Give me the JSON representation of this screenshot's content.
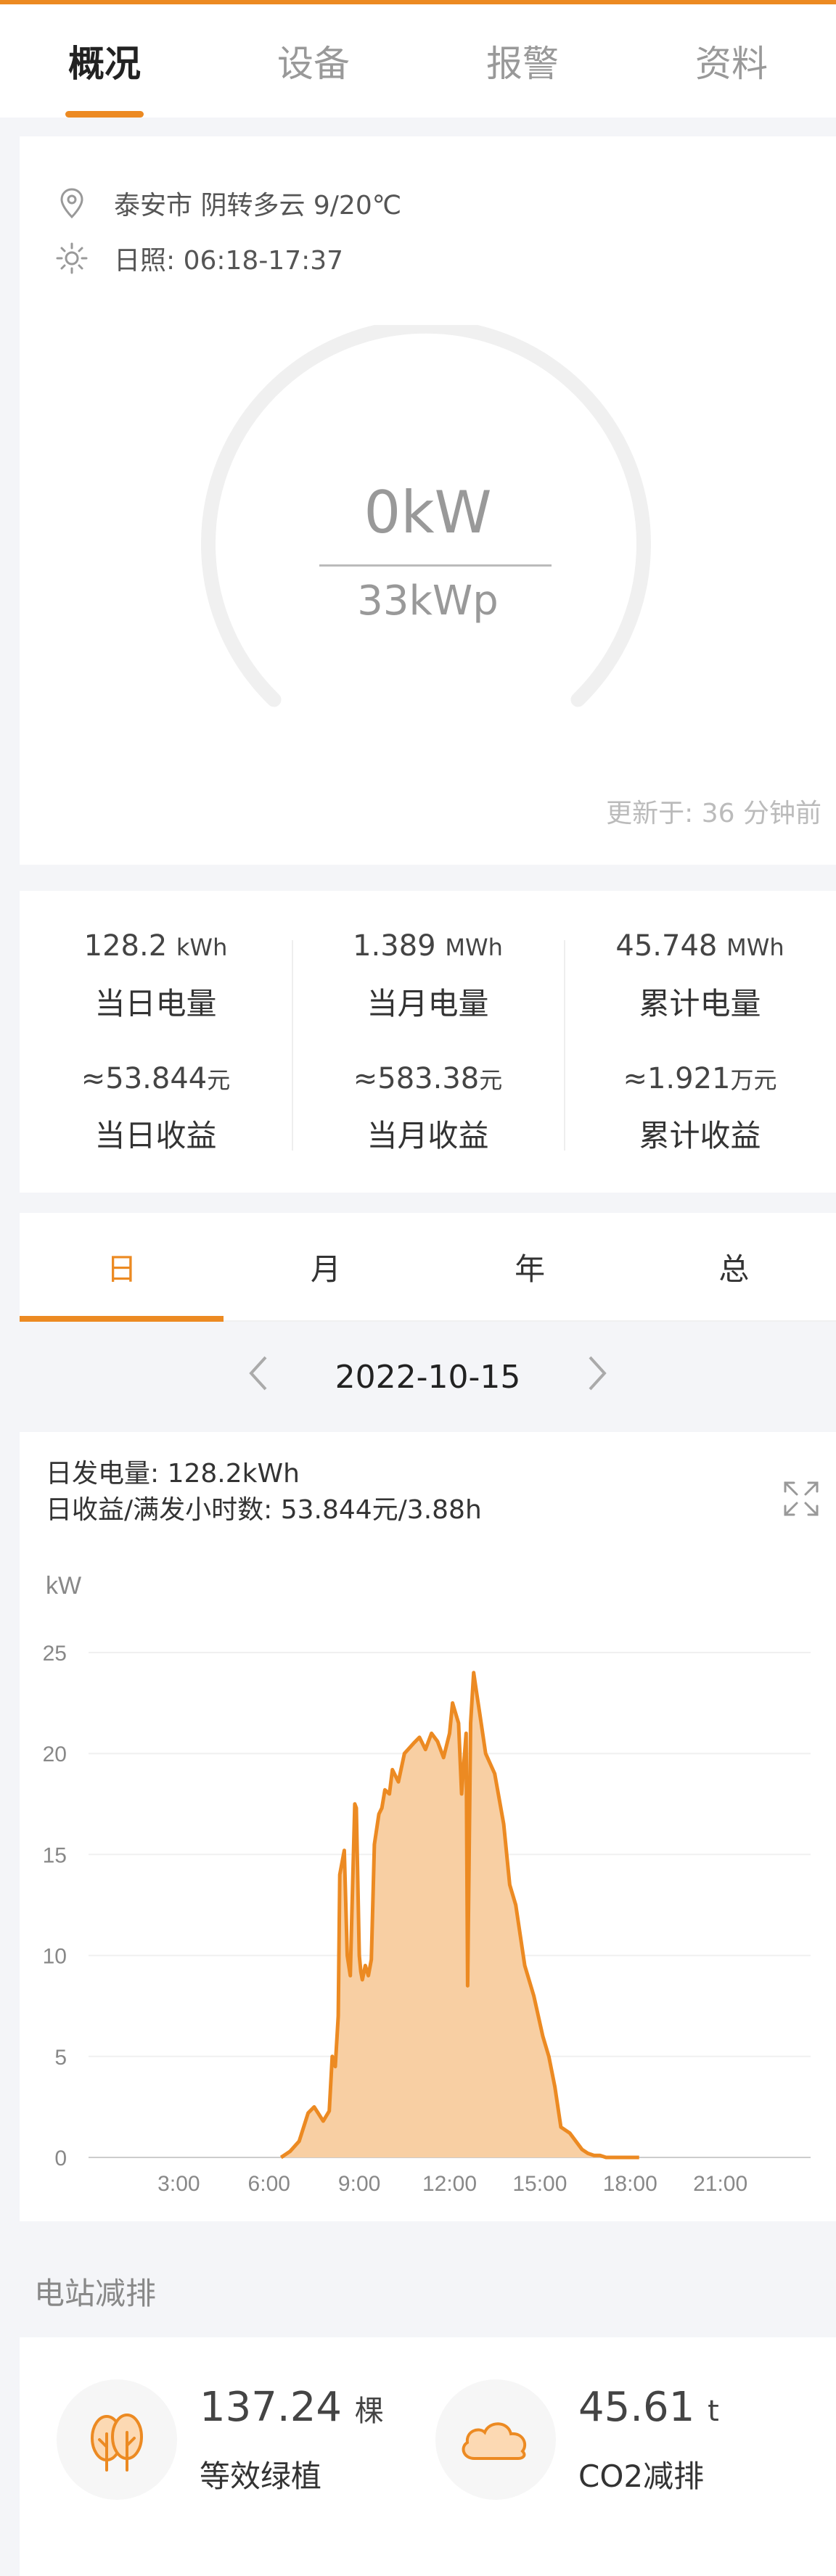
{
  "tabs": [
    {
      "label": "概况",
      "active": true
    },
    {
      "label": "设备",
      "active": false
    },
    {
      "label": "报警",
      "active": false
    },
    {
      "label": "资料",
      "active": false
    }
  ],
  "weather": {
    "location_icon": "location-pin-icon",
    "text": "泰安市 阴转多云 9/20℃",
    "sun_icon": "sun-icon",
    "sunlight": "日照: 06:18-17:37"
  },
  "gauge": {
    "power": "0kW",
    "capacity": "33kWp",
    "power_fraction": 0,
    "updated": "更新于: 36 分钟前"
  },
  "stats": [
    {
      "value": "128.2",
      "unit": "kWh",
      "label": "当日电量",
      "income_value": "≈53.844",
      "income_unit": "元",
      "income_label": "当日收益"
    },
    {
      "value": "1.389",
      "unit": "MWh",
      "label": "当月电量",
      "income_value": "≈583.38",
      "income_unit": "元",
      "income_label": "当月收益"
    },
    {
      "value": "45.748",
      "unit": "MWh",
      "label": "累计电量",
      "income_value": "≈1.921",
      "income_unit": "万元",
      "income_label": "累计收益"
    }
  ],
  "period_tabs": [
    {
      "label": "日",
      "active": true
    },
    {
      "label": "月",
      "active": false
    },
    {
      "label": "年",
      "active": false
    },
    {
      "label": "总",
      "active": false
    }
  ],
  "date_nav": {
    "prev_icon": "chevron-left-icon",
    "date": "2022-10-15",
    "next_icon": "chevron-right-icon"
  },
  "summary": {
    "line1": "日发电量: 128.2kWh",
    "line2": "日收益/满发小时数: 53.844元/3.88h",
    "expand_icon": "expand-icon"
  },
  "chart_data": {
    "type": "area",
    "ylabel": "kW",
    "ylim": [
      0,
      25
    ],
    "yticks": [
      0,
      5,
      10,
      15,
      20,
      25
    ],
    "xlim": [
      0,
      24
    ],
    "xticks": [
      "3:00",
      "6:00",
      "9:00",
      "12:00",
      "15:00",
      "18:00",
      "21:00"
    ],
    "grid": true,
    "color": "#ec8a22",
    "fill_color": "#f8cfa3",
    "series": [
      {
        "x": [
          6.4,
          6.7,
          7.0,
          7.3,
          7.5,
          7.8,
          8.0,
          8.1,
          8.2,
          8.3,
          8.35,
          8.5,
          8.6,
          8.7,
          8.75,
          8.85,
          8.9,
          9.0,
          9.05,
          9.1,
          9.2,
          9.3,
          9.4,
          9.5,
          9.65,
          9.75,
          9.85,
          10.0,
          10.1,
          10.3,
          10.5,
          10.8,
          11.0,
          11.2,
          11.4,
          11.6,
          11.8,
          12.0,
          12.1,
          12.3,
          12.4,
          12.55,
          12.6,
          12.7,
          12.8,
          12.9,
          13.0,
          13.2,
          13.5,
          13.8,
          14.0,
          14.2,
          14.5,
          14.8,
          15.1,
          15.3,
          15.5,
          15.7,
          16.0,
          16.2,
          16.4,
          16.6,
          16.8,
          17.0,
          17.2,
          17.5,
          17.8,
          18.0,
          18.3
        ],
        "y": [
          0,
          0.3,
          0.8,
          2.2,
          2.5,
          1.8,
          2.3,
          5.0,
          4.5,
          7.0,
          14.0,
          15.2,
          10.0,
          9.0,
          12.0,
          17.5,
          17.3,
          10.0,
          9.2,
          8.8,
          9.5,
          9.0,
          9.8,
          15.5,
          17.0,
          17.3,
          18.2,
          18.0,
          19.2,
          18.6,
          20.0,
          20.5,
          20.8,
          20.2,
          21.0,
          20.6,
          19.8,
          21.0,
          22.5,
          21.5,
          18.0,
          21.0,
          8.5,
          21.5,
          24.0,
          23.0,
          22.0,
          20.0,
          19.0,
          16.5,
          13.5,
          12.5,
          9.5,
          8.0,
          6.0,
          5.0,
          3.5,
          1.5,
          1.2,
          0.8,
          0.4,
          0.2,
          0.1,
          0.1,
          0,
          0,
          0,
          0,
          0
        ]
      }
    ]
  },
  "section_title": "电站减排",
  "reduction": [
    {
      "icon": "tree-icon",
      "value": "137.24",
      "unit": "棵",
      "label": "等效绿植"
    },
    {
      "icon": "cloud-icon",
      "value": "45.61",
      "unit": "t",
      "label": "CO2减排"
    }
  ],
  "colors": {
    "accent": "#ec8a22",
    "background": "#f4f5f8"
  }
}
